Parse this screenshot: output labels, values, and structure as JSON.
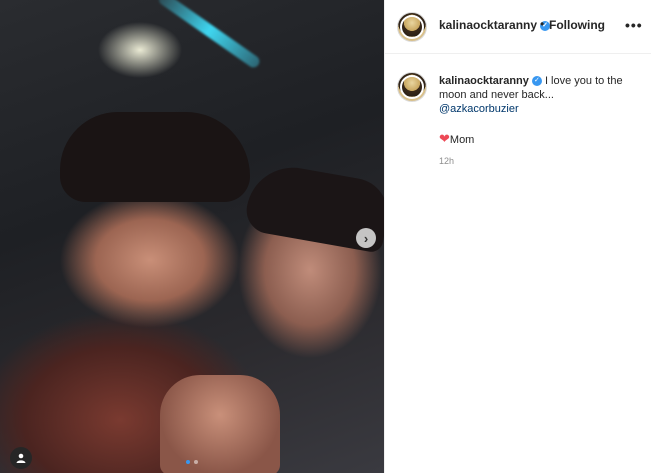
{
  "post": {
    "image": {
      "description_icon": "photo",
      "carousel_count": 2,
      "active_index": 0
    }
  },
  "header": {
    "username": "kalinaocktaranny",
    "separator": "•",
    "follow_label": "Following",
    "more_label": "•••"
  },
  "caption": {
    "username": "kalinaocktaranny",
    "text": "I love you to the moon and never back...",
    "mention": "@azkacorbuzier",
    "heart": "❤",
    "signature": "Mom",
    "time": "12h"
  },
  "icons": {
    "verified": "verified-badge",
    "next": "chevron-right-icon",
    "user_tag": "user-tag-icon"
  }
}
